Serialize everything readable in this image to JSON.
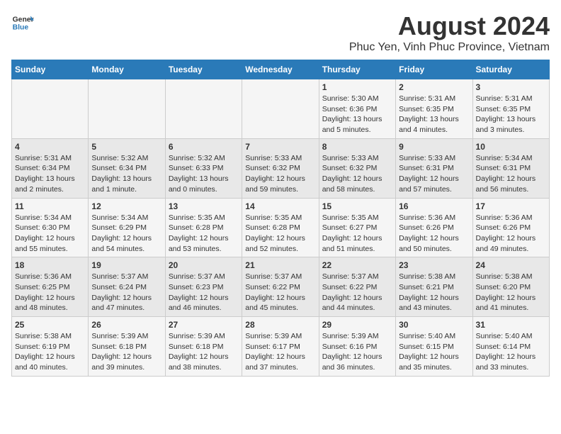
{
  "logo": {
    "text_general": "General",
    "text_blue": "Blue"
  },
  "title": "August 2024",
  "subtitle": "Phuc Yen, Vinh Phuc Province, Vietnam",
  "days_of_week": [
    "Sunday",
    "Monday",
    "Tuesday",
    "Wednesday",
    "Thursday",
    "Friday",
    "Saturday"
  ],
  "weeks": [
    [
      {
        "day": "",
        "info": ""
      },
      {
        "day": "",
        "info": ""
      },
      {
        "day": "",
        "info": ""
      },
      {
        "day": "",
        "info": ""
      },
      {
        "day": "1",
        "info": "Sunrise: 5:30 AM\nSunset: 6:36 PM\nDaylight: 13 hours\nand 5 minutes."
      },
      {
        "day": "2",
        "info": "Sunrise: 5:31 AM\nSunset: 6:35 PM\nDaylight: 13 hours\nand 4 minutes."
      },
      {
        "day": "3",
        "info": "Sunrise: 5:31 AM\nSunset: 6:35 PM\nDaylight: 13 hours\nand 3 minutes."
      }
    ],
    [
      {
        "day": "4",
        "info": "Sunrise: 5:31 AM\nSunset: 6:34 PM\nDaylight: 13 hours\nand 2 minutes."
      },
      {
        "day": "5",
        "info": "Sunrise: 5:32 AM\nSunset: 6:34 PM\nDaylight: 13 hours\nand 1 minute."
      },
      {
        "day": "6",
        "info": "Sunrise: 5:32 AM\nSunset: 6:33 PM\nDaylight: 13 hours\nand 0 minutes."
      },
      {
        "day": "7",
        "info": "Sunrise: 5:33 AM\nSunset: 6:32 PM\nDaylight: 12 hours\nand 59 minutes."
      },
      {
        "day": "8",
        "info": "Sunrise: 5:33 AM\nSunset: 6:32 PM\nDaylight: 12 hours\nand 58 minutes."
      },
      {
        "day": "9",
        "info": "Sunrise: 5:33 AM\nSunset: 6:31 PM\nDaylight: 12 hours\nand 57 minutes."
      },
      {
        "day": "10",
        "info": "Sunrise: 5:34 AM\nSunset: 6:31 PM\nDaylight: 12 hours\nand 56 minutes."
      }
    ],
    [
      {
        "day": "11",
        "info": "Sunrise: 5:34 AM\nSunset: 6:30 PM\nDaylight: 12 hours\nand 55 minutes."
      },
      {
        "day": "12",
        "info": "Sunrise: 5:34 AM\nSunset: 6:29 PM\nDaylight: 12 hours\nand 54 minutes."
      },
      {
        "day": "13",
        "info": "Sunrise: 5:35 AM\nSunset: 6:28 PM\nDaylight: 12 hours\nand 53 minutes."
      },
      {
        "day": "14",
        "info": "Sunrise: 5:35 AM\nSunset: 6:28 PM\nDaylight: 12 hours\nand 52 minutes."
      },
      {
        "day": "15",
        "info": "Sunrise: 5:35 AM\nSunset: 6:27 PM\nDaylight: 12 hours\nand 51 minutes."
      },
      {
        "day": "16",
        "info": "Sunrise: 5:36 AM\nSunset: 6:26 PM\nDaylight: 12 hours\nand 50 minutes."
      },
      {
        "day": "17",
        "info": "Sunrise: 5:36 AM\nSunset: 6:26 PM\nDaylight: 12 hours\nand 49 minutes."
      }
    ],
    [
      {
        "day": "18",
        "info": "Sunrise: 5:36 AM\nSunset: 6:25 PM\nDaylight: 12 hours\nand 48 minutes."
      },
      {
        "day": "19",
        "info": "Sunrise: 5:37 AM\nSunset: 6:24 PM\nDaylight: 12 hours\nand 47 minutes."
      },
      {
        "day": "20",
        "info": "Sunrise: 5:37 AM\nSunset: 6:23 PM\nDaylight: 12 hours\nand 46 minutes."
      },
      {
        "day": "21",
        "info": "Sunrise: 5:37 AM\nSunset: 6:22 PM\nDaylight: 12 hours\nand 45 minutes."
      },
      {
        "day": "22",
        "info": "Sunrise: 5:37 AM\nSunset: 6:22 PM\nDaylight: 12 hours\nand 44 minutes."
      },
      {
        "day": "23",
        "info": "Sunrise: 5:38 AM\nSunset: 6:21 PM\nDaylight: 12 hours\nand 43 minutes."
      },
      {
        "day": "24",
        "info": "Sunrise: 5:38 AM\nSunset: 6:20 PM\nDaylight: 12 hours\nand 41 minutes."
      }
    ],
    [
      {
        "day": "25",
        "info": "Sunrise: 5:38 AM\nSunset: 6:19 PM\nDaylight: 12 hours\nand 40 minutes."
      },
      {
        "day": "26",
        "info": "Sunrise: 5:39 AM\nSunset: 6:18 PM\nDaylight: 12 hours\nand 39 minutes."
      },
      {
        "day": "27",
        "info": "Sunrise: 5:39 AM\nSunset: 6:18 PM\nDaylight: 12 hours\nand 38 minutes."
      },
      {
        "day": "28",
        "info": "Sunrise: 5:39 AM\nSunset: 6:17 PM\nDaylight: 12 hours\nand 37 minutes."
      },
      {
        "day": "29",
        "info": "Sunrise: 5:39 AM\nSunset: 6:16 PM\nDaylight: 12 hours\nand 36 minutes."
      },
      {
        "day": "30",
        "info": "Sunrise: 5:40 AM\nSunset: 6:15 PM\nDaylight: 12 hours\nand 35 minutes."
      },
      {
        "day": "31",
        "info": "Sunrise: 5:40 AM\nSunset: 6:14 PM\nDaylight: 12 hours\nand 33 minutes."
      }
    ]
  ]
}
